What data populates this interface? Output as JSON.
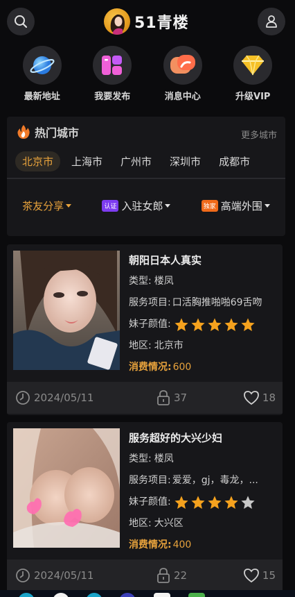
{
  "header": {
    "logo_text": "51青楼"
  },
  "quick_links": [
    {
      "label": "最新地址",
      "icon": "planet-icon"
    },
    {
      "label": "我要发布",
      "icon": "publish-icon"
    },
    {
      "label": "消息中心",
      "icon": "message-icon"
    },
    {
      "label": "升级VIP",
      "icon": "diamond-icon"
    }
  ],
  "hot_cities": {
    "title": "热门城市",
    "more": "更多城市",
    "cities": [
      "北京市",
      "上海市",
      "广州市",
      "深圳市",
      "成都市"
    ],
    "active_index": 0
  },
  "filters": [
    {
      "label": "茶友分享",
      "tag": ""
    },
    {
      "label": "入驻女郎",
      "tag": "认证"
    },
    {
      "label": "高端外围",
      "tag": "独家"
    }
  ],
  "listings": [
    {
      "title": "朝阳日本人真实",
      "type_label": "类型:",
      "type": "楼凤",
      "service_label": "服务项目:",
      "service": "口活胸推啪啪69舌吻",
      "rating_label": "妹子颜值:",
      "rating": 5,
      "region_label": "地区:",
      "region": "北京市",
      "price_label": "消费情况:",
      "price": "600",
      "date": "2024/05/11",
      "views": "37",
      "likes": "18"
    },
    {
      "title": "服务超好的大兴少妇",
      "type_label": "类型:",
      "type": "楼凤",
      "service_label": "服务项目:",
      "service": "爱爱，gj，毒龙，...",
      "rating_label": "妹子颜值:",
      "rating": 4,
      "region_label": "地区:",
      "region": "大兴区",
      "price_label": "消费情况:",
      "price": "400",
      "date": "2024/05/11",
      "views": "22",
      "likes": "15"
    }
  ],
  "colors": {
    "accent": "#e7a23c",
    "background": "#0b0b0d",
    "card": "#17171a"
  }
}
